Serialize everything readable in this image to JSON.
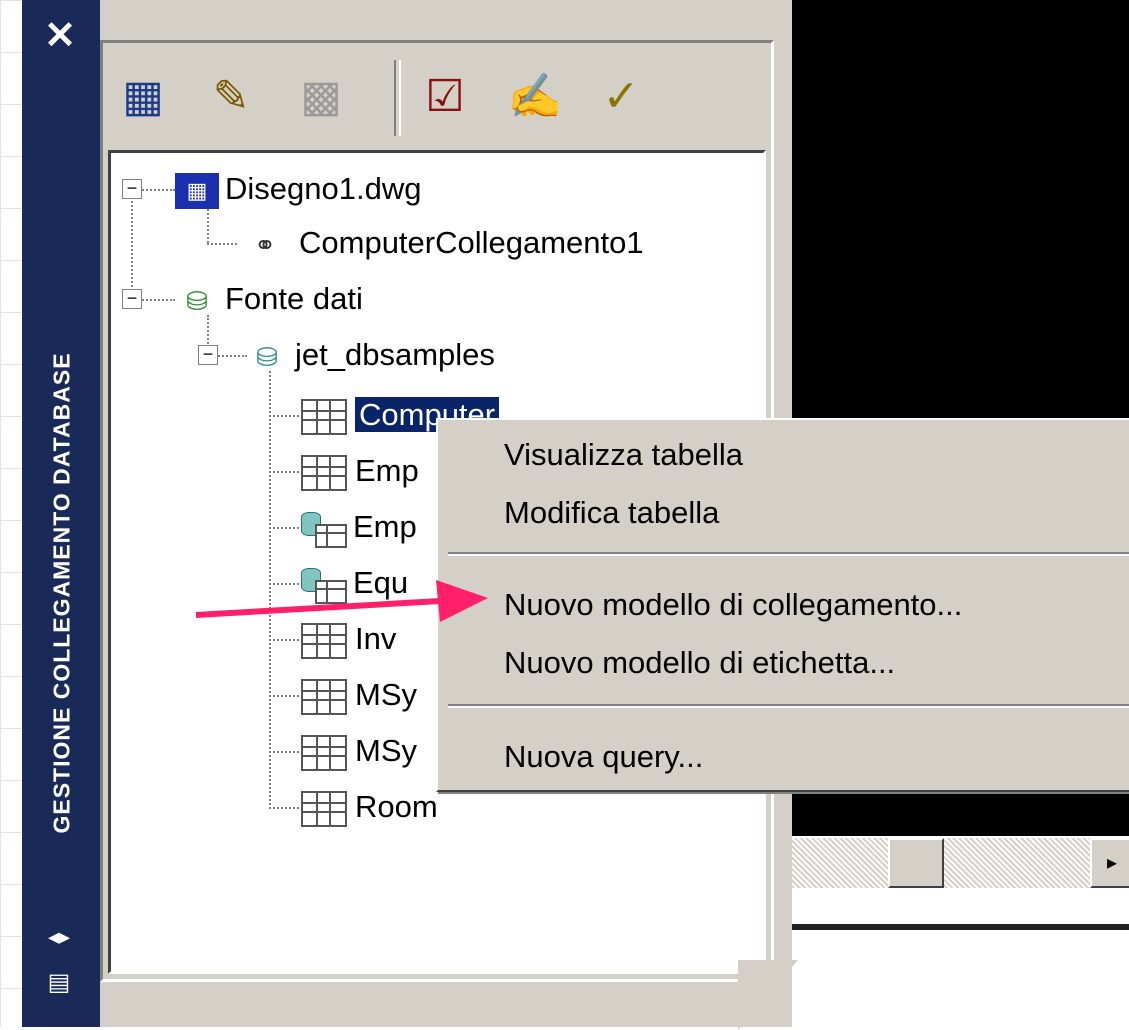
{
  "palette": {
    "title": "GESTIONE COLLEGAMENTO DATABASE",
    "close_glyph": "✕",
    "autohide_glyph": "◂▸",
    "properties_glyph": "▤"
  },
  "toolbar": {
    "buttons": [
      {
        "name": "view-table-button",
        "icon": "table-icon",
        "glyph": "▦"
      },
      {
        "name": "edit-table-button",
        "icon": "edit-table-icon",
        "glyph": "✎"
      },
      {
        "name": "new-query-button",
        "icon": "query-icon",
        "glyph": "▩"
      },
      {
        "name": "link-template-button",
        "icon": "link-template-icon",
        "glyph": "☑"
      },
      {
        "name": "label-template-button",
        "icon": "label-template-icon",
        "glyph": "✍"
      },
      {
        "name": "synchronize-button",
        "icon": "check-icon",
        "glyph": "✓"
      }
    ]
  },
  "tree": {
    "drawing": "Disegno1.dwg",
    "link": "ComputerCollegamento1",
    "data_sources": "Fonte dati",
    "database": "jet_dbsamples",
    "tables": [
      "Computer",
      "Emp",
      "Emp",
      "Equ",
      "Inv",
      "MSy",
      "MSy",
      "Room"
    ],
    "expander_glyph": "−"
  },
  "context_menu": {
    "items": [
      "Visualizza tabella",
      "Modifica tabella",
      "Nuovo modello di collegamento...",
      "Nuovo modello di etichetta...",
      "Nuova query..."
    ]
  },
  "scroll": {
    "right_arrow_glyph": "▸"
  },
  "colors": {
    "title_bar": "#1a2a58",
    "selection": "#0a246a",
    "annotation_arrow": "#ff1f6a",
    "face": "#d4d0c8"
  }
}
